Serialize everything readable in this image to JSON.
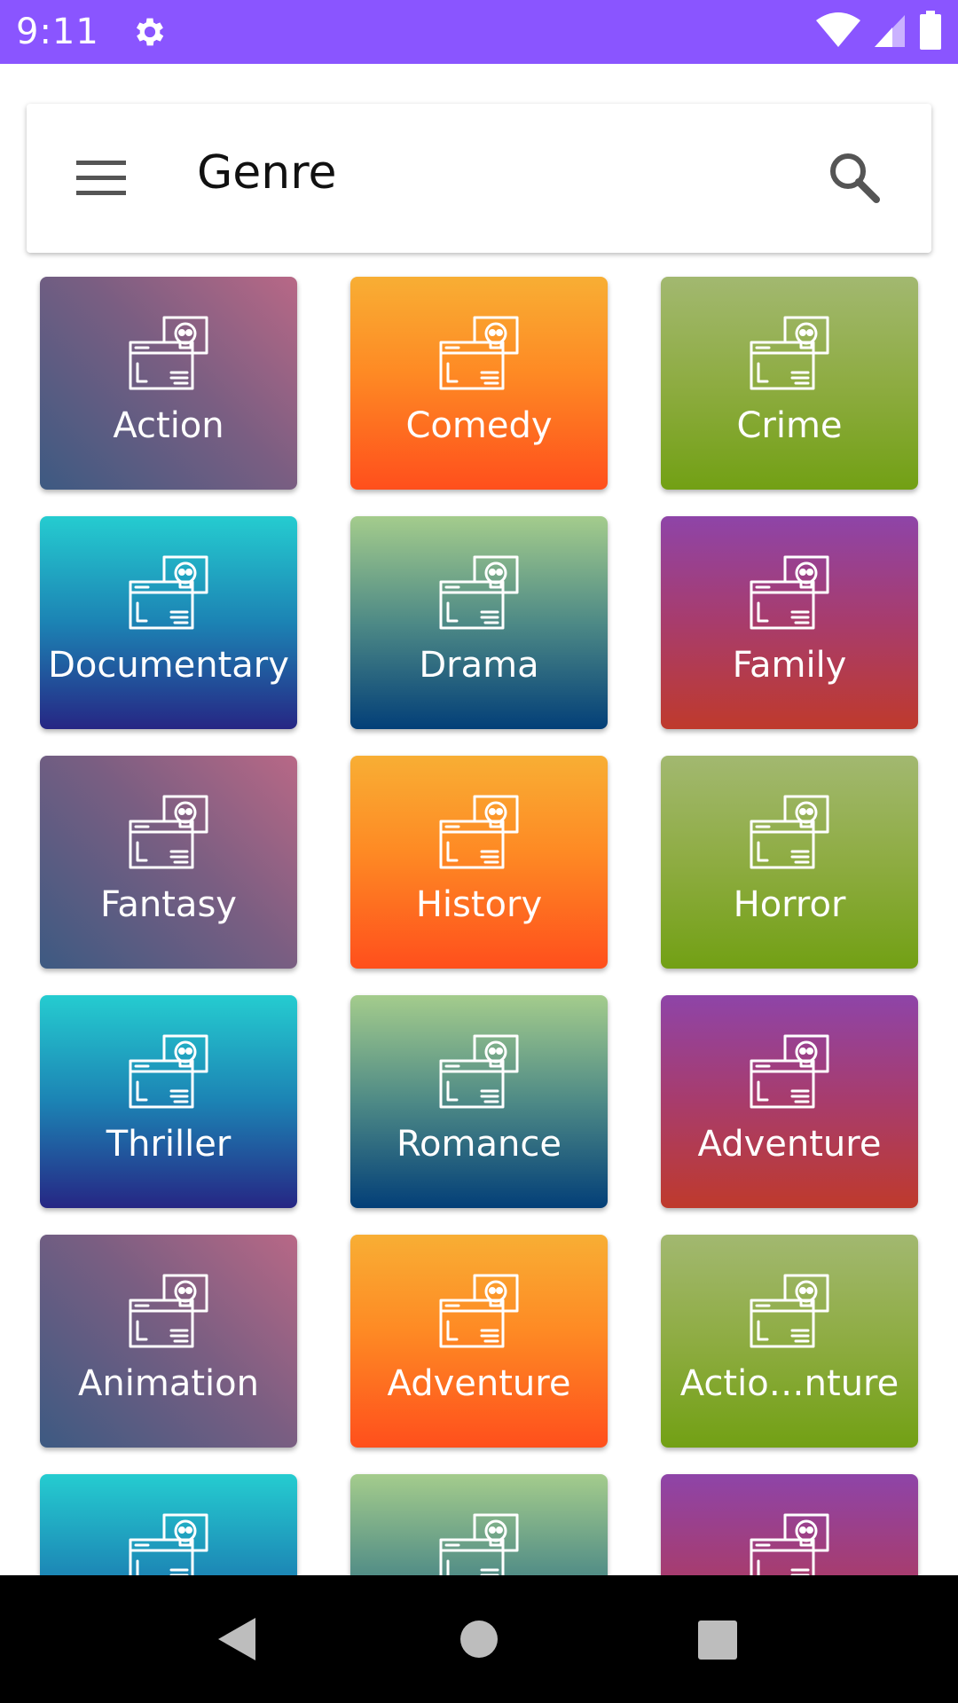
{
  "status_bar": {
    "time": "9:11"
  },
  "app_bar": {
    "title": "Genre"
  },
  "genres": [
    {
      "label": "Action"
    },
    {
      "label": "Comedy"
    },
    {
      "label": "Crime"
    },
    {
      "label": "Documentary"
    },
    {
      "label": "Drama"
    },
    {
      "label": "Family"
    },
    {
      "label": "Fantasy"
    },
    {
      "label": "History"
    },
    {
      "label": "Horror"
    },
    {
      "label": "Thriller"
    },
    {
      "label": "Romance"
    },
    {
      "label": "Adventure"
    },
    {
      "label": "Animation"
    },
    {
      "label": "Adventure"
    },
    {
      "label": "Actio…nture"
    },
    {
      "label": ""
    },
    {
      "label": ""
    },
    {
      "label": ""
    }
  ],
  "colors": {
    "status_bar": "#8a55ff",
    "tile_palette": [
      "purple",
      "orange",
      "green",
      "cyan",
      "teal",
      "magenta"
    ]
  }
}
